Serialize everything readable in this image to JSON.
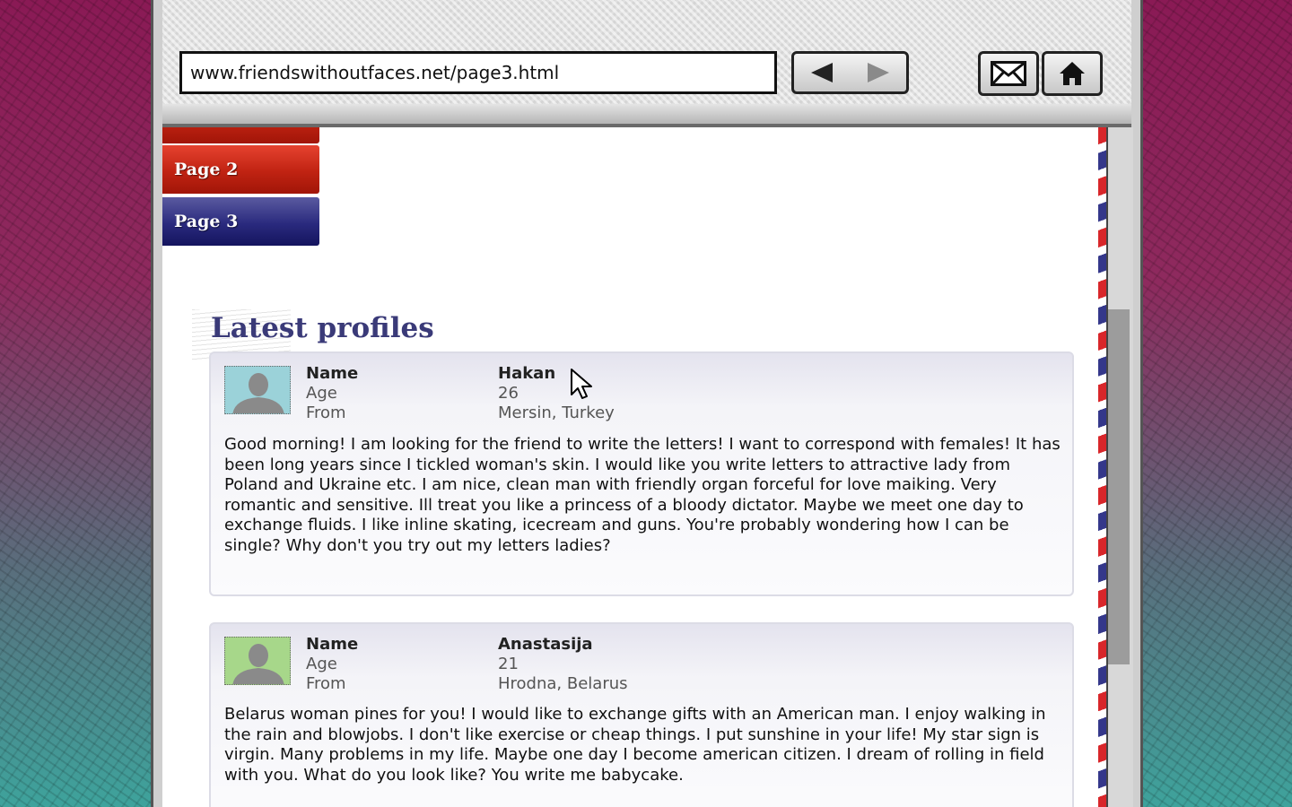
{
  "browser": {
    "url": "www.friendswithoutfaces.net/page3.html",
    "back_icon": "back-arrow-icon",
    "forward_icon": "forward-arrow-icon",
    "mail_icon": "envelope-icon",
    "home_icon": "home-icon"
  },
  "nav": {
    "tabs": [
      {
        "label": "",
        "color": "#c02312"
      },
      {
        "label": "Page 2",
        "color": "#c02312"
      },
      {
        "label": "Page 3",
        "color": "#2a2a7e"
      }
    ]
  },
  "section": {
    "title": "Latest profiles"
  },
  "profiles": [
    {
      "name_label": "Name",
      "age_label": "Age",
      "from_label": "From",
      "name": "Hakan",
      "age": "26",
      "from": "Mersin, Turkey",
      "avatar_color": "#9bd2d9",
      "bio": "Good morning! I am looking for the friend to write the letters!  I want to correspond with females! It has been long years since I tickled woman's skin. I would like you write letters to attractive lady from Poland and Ukraine etc. I am nice, clean man with friendly organ forceful for love maiking. Very romantic and sensitive. Ill treat you like a princess of a bloody dictator. Maybe we meet one day to exchange fluids. I like inline skating, icecream and guns. You're probably wondering how I can be single? Why don't you try out my letters ladies?"
    },
    {
      "name_label": "Name",
      "age_label": "Age",
      "from_label": "From",
      "name": "Anastasija",
      "age": "21",
      "from": "Hrodna, Belarus",
      "avatar_color": "#a7d78a",
      "bio": "Belarus woman pines for you! I would like to exchange gifts with an American man. I enjoy walking in the rain and blowjobs. I don't like exercise or cheap things. I put sunshine in your life! My star sign is virgin. Many problems in my life. Maybe one day I become american citizen. I dream of rolling in field with you. What do you look like? You write me babycake."
    }
  ]
}
